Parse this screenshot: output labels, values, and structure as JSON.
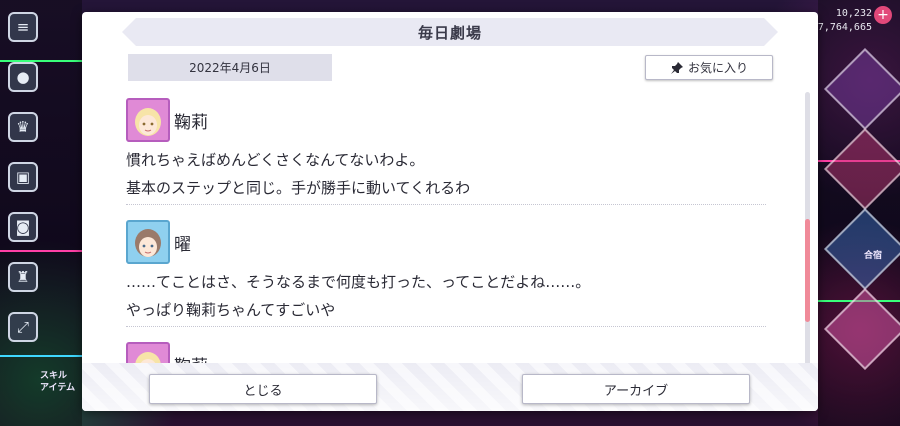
{
  "modal": {
    "title": "毎日劇場",
    "date": "2022年4月6日",
    "favorite_label": "お気に入り",
    "close_label": "とじる",
    "archive_label": "アーカイブ"
  },
  "dialog": [
    {
      "speaker": "鞠莉",
      "avatar_color": "#e08ad6",
      "lines": [
        "慣れちゃえばめんどくさくなんてないわよ。",
        "基本のステップと同じ。手が勝手に動いてくれるわ"
      ]
    },
    {
      "speaker": "曜",
      "avatar_color": "#8fd0ef",
      "lines": [
        "……てことはさ、そうなるまで何度も打った、ってことだよね……。",
        "やっぱり鞠莉ちゃんてすごいや"
      ]
    },
    {
      "speaker": "鞠莉",
      "avatar_color": "#e08ad6",
      "lines": []
    }
  ],
  "hud": {
    "value_top": "10,232",
    "value_bottom": "7,764,665"
  },
  "background": {
    "labels": [
      "スキル",
      "アイテム",
      "合宿"
    ],
    "colors": {
      "neon_green": "#39ff7a",
      "neon_pink": "#ff3fa6",
      "neon_cyan": "#3fd8ff"
    }
  },
  "icons": {
    "menu": "menu-icon",
    "favorite": "pin-icon"
  }
}
